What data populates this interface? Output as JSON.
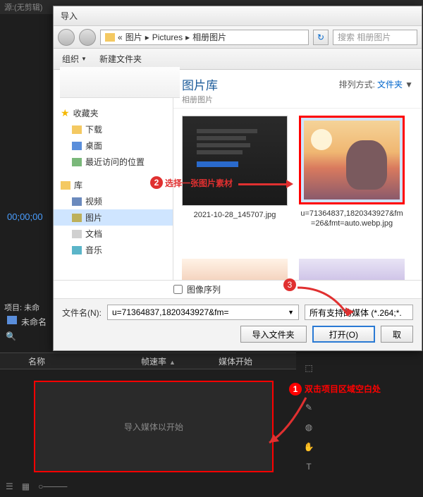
{
  "app": {
    "top_label": "源:(无剪辑)",
    "timecode": "00;00;00",
    "project_label": "项目: 未命",
    "project_name": "未命名",
    "drop_hint": "导入媒体以开始"
  },
  "columns": {
    "name": "名称",
    "fps": "帧速率",
    "start": "媒体开始"
  },
  "tools": [
    "⬚",
    "↔",
    "✎",
    "◍",
    "✋",
    "T"
  ],
  "annotations": {
    "a1": "双击项目区域空白处",
    "a2": "选择一张图片素材"
  },
  "dialog": {
    "title": "导入",
    "path": [
      "«",
      "图片",
      "Pictures",
      "相册图片"
    ],
    "search_placeholder": "搜索 相册图片",
    "toolbar": {
      "organize": "组织",
      "newfolder": "新建文件夹"
    },
    "tree": {
      "fav": "收藏夹",
      "fav_items": [
        "下载",
        "桌面",
        "最近访问的位置"
      ],
      "lib": "库",
      "lib_items": [
        "视频",
        "图片",
        "文档",
        "音乐"
      ]
    },
    "content": {
      "lib_title": "图片库",
      "lib_sub": "相册图片",
      "arrange_label": "排列方式:",
      "arrange_value": "文件夹",
      "thumb1": "2021-10-28_145707.jpg",
      "thumb2": "u=71364837,1820343927&fm=26&fmt=auto.webp.jpg"
    },
    "seq_label": "图像序列",
    "filename_label": "文件名(N):",
    "filename_value": "u=71364837,1820343927&fm=",
    "filter_value": "所有支持的媒体 (*.264;*.",
    "btn_importfolder": "导入文件夹",
    "btn_open": "打开(O)",
    "btn_cancel": "取"
  }
}
